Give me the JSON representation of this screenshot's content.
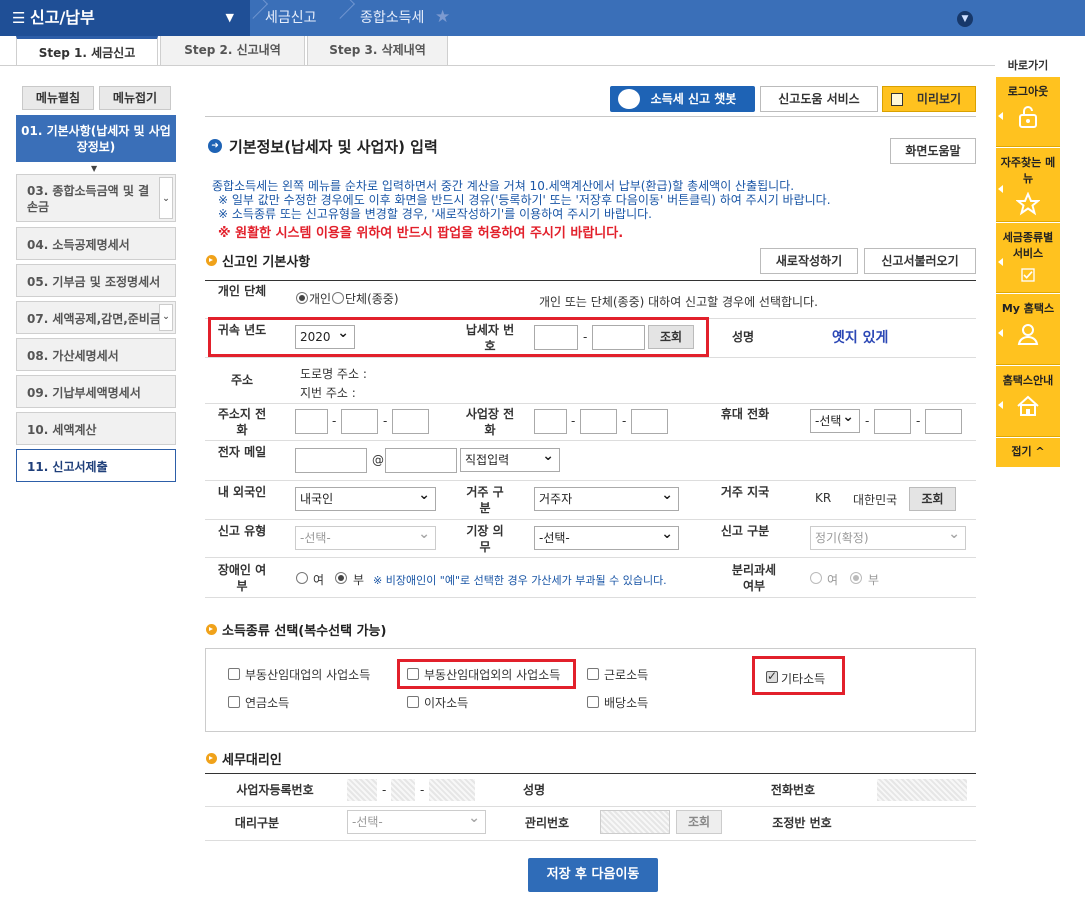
{
  "topbar": {
    "menu_label": "신고/납부",
    "crumb1": "세금신고",
    "crumb2": "종합소득세"
  },
  "steps": [
    {
      "label": "Step 1. 세금신고"
    },
    {
      "label": "Step 2. 신고내역"
    },
    {
      "label": "Step 3. 삭제내역"
    }
  ],
  "leftnav": {
    "expand_label": "메뉴펼침",
    "collapse_label": "메뉴접기",
    "items": [
      {
        "label": "01. 기본사항(납세자 및 사업장정보)"
      },
      {
        "label": "03. 종합소득금액 및 결손금"
      },
      {
        "label": "04. 소득공제명세서"
      },
      {
        "label": "05. 기부금 및 조정명세서"
      },
      {
        "label": "07. 세액공제,감면,준비금"
      },
      {
        "label": "08. 가산세명세서"
      },
      {
        "label": "09. 기납부세액명세서"
      },
      {
        "label": "10. 세액계산"
      },
      {
        "label": "11. 신고서제출"
      }
    ]
  },
  "rightpanel": {
    "title": "바로가기",
    "items": [
      {
        "label": "로그아웃",
        "icon": "lock-icon"
      },
      {
        "label": "자주찾는 메뉴",
        "icon": "star-icon"
      },
      {
        "label": "세금종류별 서비스",
        "icon": "check-icon"
      },
      {
        "label": "My 홈택스",
        "icon": "person-icon"
      },
      {
        "label": "홈택스안내",
        "icon": "house-icon"
      }
    ],
    "fold_label": "접기 ^"
  },
  "toolbar": {
    "chatbot_label": "소득세 신고 챗봇",
    "help_service_label": "신고도움 서비스",
    "preview_label": "미리보기"
  },
  "main": {
    "title": "기본정보(납세자 및 사업자) 입력",
    "screen_help_label": "화면도움말",
    "info1": "종합소득세는 왼쪽 메뉴를 순차로 입력하면서 중간 계산을 거쳐 10.세액계산에서 납부(환급)할 총세액이 산출됩니다.",
    "info2": "※ 일부 값만 수정한 경우에도 이후 화면을 반드시 경유('등록하기' 또는 '저장후 다음이동' 버튼클릭) 하여 주시기 바랍니다.",
    "info3": "※ 소득종류 또는 신고유형을 변경할 경우, '새로작성하기'를 이용하여 주시기 바랍니다.",
    "warning": "※ 원활한 시스템 이용을 위하여 반드시 팝업을 허용하여 주시기 바랍니다."
  },
  "reporter": {
    "section_title": "신고인 기본사항",
    "new_label": "새로작성하기",
    "load_label": "신고서불러오기",
    "type_label": "개인 단체",
    "type_opt1": "개인",
    "type_opt2": "단체(종중)",
    "type_note": "개인 또는 단체(종중) 대하여 신고할 경우에 선택합니다.",
    "year_label": "귀속 년도",
    "year_value": "2020",
    "taxid_label": "납세자 번호",
    "lookup_label": "조회",
    "name_label": "성명",
    "name_value": "옛지 있게",
    "address_label": "주소",
    "road_addr_label": "도로명 주소 :",
    "lot_addr_label": "지번 주소 :",
    "addr_phone_label": "주소지 전화",
    "biz_phone_label": "사업장 전화",
    "mobile_label": "휴대 전화",
    "mobile_select": "-선택",
    "email_label": "전자 메일",
    "email_select": "직접입력",
    "domestic_label": "내 외국인",
    "domestic_value": "내국인",
    "residence_label": "거주 구분",
    "residence_value": "거주자",
    "region_label": "거주 지국",
    "region_code": "KR",
    "region_name": "대한민국",
    "report_type_label": "신고 유형",
    "report_type_value": "-선택-",
    "bookkeeping_label": "기장 의무",
    "bookkeeping_value": "-선택-",
    "report_class_label": "신고 구분",
    "report_class_value": "정기(확정)",
    "disabled_label": "장애인 여부",
    "yes": "여",
    "no": "부",
    "disabled_note": "※ 비장애인이 \"예\"로 선택한 경우 가산세가 부과될 수 있습니다.",
    "separate_label": "분리과세 여부"
  },
  "income": {
    "section_title": "소득종류 선택(복수선택 가능)",
    "items": [
      {
        "label": "부동산임대업의 사업소득",
        "checked": false
      },
      {
        "label": "부동산임대업외의 사업소득",
        "checked": false
      },
      {
        "label": "근로소득",
        "checked": false
      },
      {
        "label": "기타소득",
        "checked": true
      },
      {
        "label": "연금소득",
        "checked": false
      },
      {
        "label": "이자소득",
        "checked": false
      },
      {
        "label": "배당소득",
        "checked": false
      }
    ]
  },
  "agent": {
    "section_title": "세무대리인",
    "bizno_label": "사업자등록번호",
    "name_label": "성명",
    "phone_label": "전화번호",
    "type_label": "대리구분",
    "type_value": "-선택-",
    "mgmt_label": "관리번호",
    "lookup_label": "조회",
    "team_label": "조정반 번호"
  },
  "footer": {
    "save_label": "저장 후 다음이동"
  },
  "colors": {
    "topbar": "#3a6fb8",
    "accent": "#1e63b5",
    "highlight": "#e2202b",
    "quicklink": "#ffc21f"
  }
}
